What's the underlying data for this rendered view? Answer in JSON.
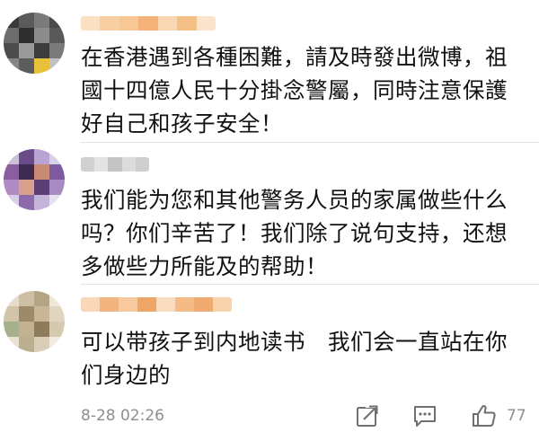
{
  "colors": {
    "text": "#111111",
    "meta": "#8e8e8e",
    "icon": "#6f6f6f",
    "divider": "#e3e3e3",
    "username_blur": "#f3b27a"
  },
  "comments": [
    {
      "lines": [
        "在香港遇到各種困難，請及時發出微博，祖",
        "國十四億人民十分掛念警屬，同時注意保護",
        "好自己和孩子安全！"
      ]
    },
    {
      "lines": [
        "我们能为您和其他警务人员的家属做些什么",
        "吗？你们辛苦了！我们除了说句支持，还想",
        "多做些力所能及的帮助！"
      ]
    },
    {
      "lines": [
        "可以带孩子到内地读书　我们会一直站在你",
        "们身边的"
      ],
      "timestamp": "8-28 02:26",
      "like_count": "77"
    }
  ],
  "icons": {
    "share": "share-icon",
    "comment": "comment-icon",
    "like": "thumbs-up-icon"
  }
}
